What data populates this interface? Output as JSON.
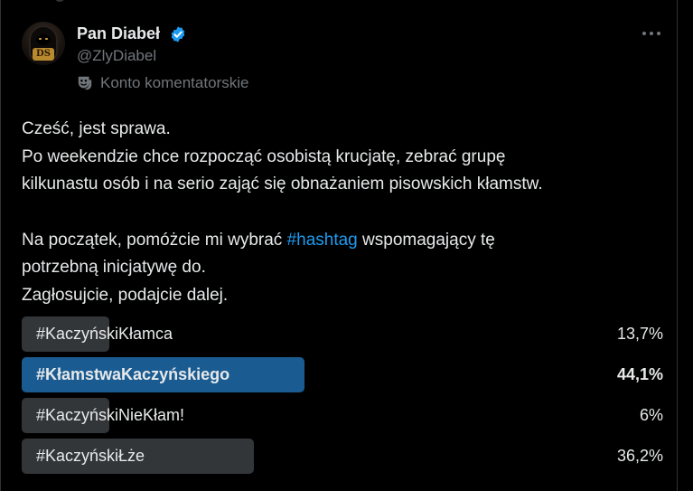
{
  "author": {
    "name": "Pan Diabeł",
    "handle": "@ZlyDiabel",
    "avatar_icon": "hooded-figure-avatar",
    "avatar_emblem": "DS",
    "verified_icon": "verified-badge-icon",
    "account_label_icon": "theater-mask-icon",
    "account_label": "Konto komentatorskie"
  },
  "more_icon": "more-options-icon",
  "tweet": {
    "line1": "Cześć, jest sprawa.",
    "line2": "Po weekendzie chce rozpocząć osobistą krucjatę, zebrać grupę",
    "line3": "kilkunastu osób i na serio zająć się obnażaniem pisowskich kłamstw.",
    "line5_before": "Na początek, pomóżcie mi wybrać ",
    "line5_hashtag": "#hashtag",
    "line5_after": " wspomagający tę",
    "line6": "potrzebną inicjatywę do.",
    "line7": "Zagłosujcie, podajcie dalej."
  },
  "poll": {
    "options": [
      {
        "label": "#KaczyńskiKłamca",
        "percent_text": "13,7%",
        "percent": 13.7,
        "winner": false
      },
      {
        "label": "#KłamstwaKaczyńskiego",
        "percent_text": "44,1%",
        "percent": 44.1,
        "winner": true
      },
      {
        "label": "#KaczyńskiNieKłam!",
        "percent_text": "6%",
        "percent": 6,
        "winner": false
      },
      {
        "label": "#KaczyńskiŁże",
        "percent_text": "36,2%",
        "percent": 36.2,
        "winner": false
      }
    ]
  },
  "colors": {
    "background": "#000000",
    "text": "#e7e9ea",
    "muted": "#71767b",
    "accent": "#1d9bf0",
    "poll_bar": "#333639",
    "poll_bar_winner": "#1a5c91"
  }
}
